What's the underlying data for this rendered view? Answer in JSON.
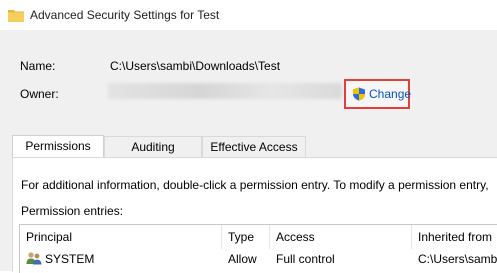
{
  "window": {
    "title": "Advanced Security Settings for Test"
  },
  "header": {
    "name_label": "Name:",
    "name_value": "C:\\Users\\sambi\\Downloads\\Test",
    "owner_label": "Owner:",
    "change_label": "Change"
  },
  "tabs": [
    {
      "label": "Permissions",
      "active": true
    },
    {
      "label": "Auditing",
      "active": false
    },
    {
      "label": "Effective Access",
      "active": false
    }
  ],
  "permissions": {
    "info": "For additional information, double-click a permission entry. To modify a permission entry,",
    "entries_label": "Permission entries:",
    "columns": [
      "Principal",
      "Type",
      "Access",
      "Inherited from"
    ],
    "rows": [
      {
        "principal": "SYSTEM",
        "type": "Allow",
        "access": "Full control",
        "inherited_from": "C:\\Users\\sambi\\"
      }
    ]
  },
  "colors": {
    "link": "#0b52c2",
    "highlight_border": "#e0403a",
    "folder": "#e8b93a"
  },
  "icons": [
    "folder-icon",
    "shield-icon",
    "user-group-icon"
  ]
}
